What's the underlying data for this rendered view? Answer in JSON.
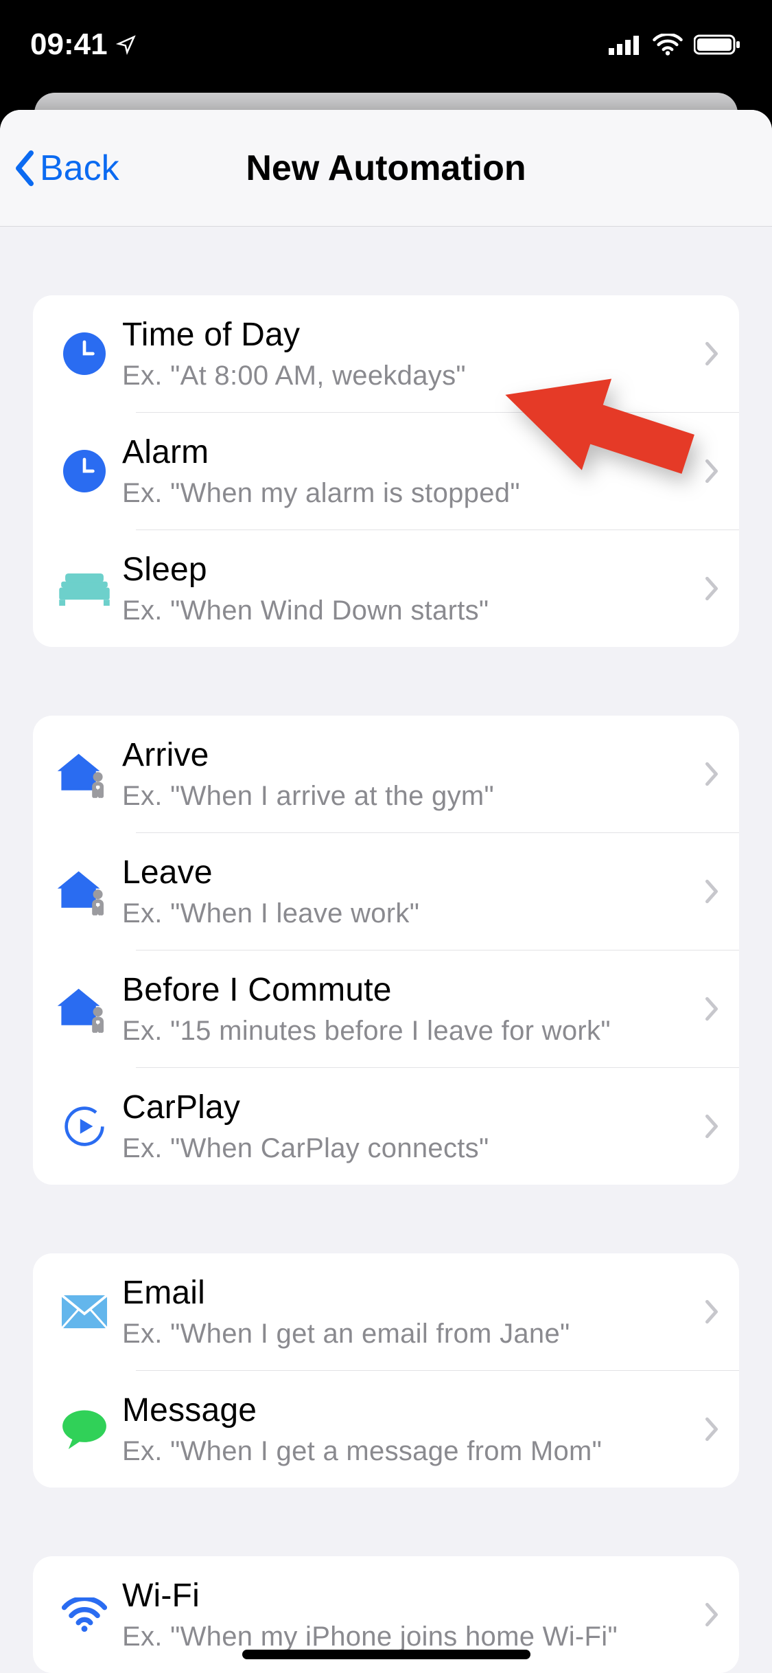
{
  "status": {
    "time": "09:41"
  },
  "nav": {
    "back_label": "Back",
    "title": "New Automation"
  },
  "groups": [
    {
      "rows": [
        {
          "icon": "clock",
          "title": "Time of Day",
          "subtitle": "Ex. \"At 8:00 AM, weekdays\""
        },
        {
          "icon": "clock",
          "title": "Alarm",
          "subtitle": "Ex. \"When my alarm is stopped\""
        },
        {
          "icon": "bed",
          "title": "Sleep",
          "subtitle": "Ex. \"When Wind Down starts\""
        }
      ]
    },
    {
      "rows": [
        {
          "icon": "home-person",
          "title": "Arrive",
          "subtitle": "Ex. \"When I arrive at the gym\""
        },
        {
          "icon": "home-person",
          "title": "Leave",
          "subtitle": "Ex. \"When I leave work\""
        },
        {
          "icon": "home-person",
          "title": "Before I Commute",
          "subtitle": "Ex. \"15 minutes before I leave for work\""
        },
        {
          "icon": "carplay",
          "title": "CarPlay",
          "subtitle": "Ex. \"When CarPlay connects\""
        }
      ]
    },
    {
      "rows": [
        {
          "icon": "mail",
          "title": "Email",
          "subtitle": "Ex. \"When I get an email from Jane\""
        },
        {
          "icon": "message",
          "title": "Message",
          "subtitle": "Ex. \"When I get a message from Mom\""
        }
      ]
    },
    {
      "rows": [
        {
          "icon": "wifi",
          "title": "Wi-Fi",
          "subtitle": "Ex. \"When my iPhone joins home Wi-Fi\""
        }
      ]
    }
  ],
  "colors": {
    "accent_blue": "#2a6cf1",
    "teal": "#6dd0cb",
    "sky": "#63b6ec",
    "green": "#30d158",
    "arrow": "#e53a27"
  }
}
